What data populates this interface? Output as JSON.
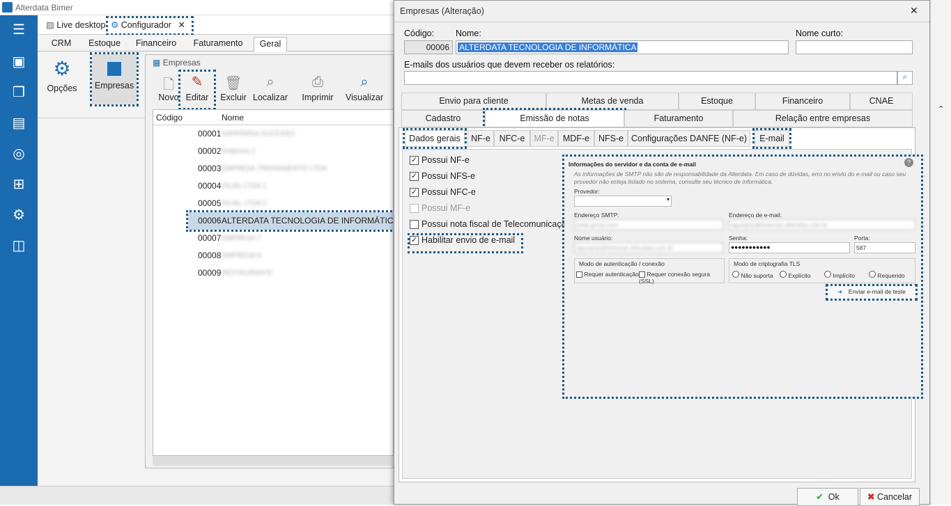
{
  "app": {
    "title": "Alterdata Bimer",
    "doc_tabs": [
      "Live desktop",
      "Configurador"
    ],
    "ribbon_tabs": [
      "CRM",
      "Estoque",
      "Financeiro",
      "Faturamento",
      "Geral"
    ],
    "ribbon_buttons": [
      "Opções",
      "Empresas"
    ]
  },
  "empresas": {
    "title": "Empresas",
    "toolbar": [
      "Novo",
      "Editar",
      "Excluir",
      "Localizar",
      "Imprimir",
      "Visualizar"
    ],
    "columns": [
      "Código",
      "Nome"
    ],
    "rows": [
      {
        "code": "00001",
        "name": "SAPATARIA SUCESSO"
      },
      {
        "code": "00002",
        "name": "Empresa 2"
      },
      {
        "code": "00003",
        "name": "EMPRESA TREINAMENTO LTDA"
      },
      {
        "code": "00004",
        "name": "FILIAL LTDA 1"
      },
      {
        "code": "00005",
        "name": "FILIAL LTDA 2"
      },
      {
        "code": "00006",
        "name": "ALTERDATA TECNOLOGIA DE INFORMÁTICA"
      },
      {
        "code": "00007",
        "name": "EMPRESA 7"
      },
      {
        "code": "00008",
        "name": "EMPRESA 8"
      },
      {
        "code": "00009",
        "name": "RESTAURANTE"
      }
    ]
  },
  "dialog": {
    "title": "Empresas (Alteração)",
    "codigo_label": "Código:",
    "codigo": "00006",
    "nome_label": "Nome:",
    "nome": "ALTERDATA TECNOLOGIA DE INFORMÁTICA",
    "nome_curto_label": "Nome curto:",
    "nome_curto": "",
    "emails_label": "E-mails dos usuários que devem receber os relatórios:",
    "tabs_row1": [
      "Envio para cliente",
      "Metas de venda",
      "Estoque",
      "Financeiro",
      "CNAE"
    ],
    "tabs_row2": [
      "Cadastro",
      "Emissão de notas",
      "Faturamento",
      "Relação entre empresas"
    ],
    "subtabs": [
      "Dados gerais",
      "NF-e",
      "NFC-e",
      "MF-e",
      "MDF-e",
      "NFS-e",
      "Configurações DANFE (NF-e)",
      "E-mail"
    ],
    "checks": [
      {
        "label": "Possui NF-e",
        "checked": true,
        "enabled": true
      },
      {
        "label": "Possui NFS-e",
        "checked": true,
        "enabled": true
      },
      {
        "label": "Possui NFC-e",
        "checked": true,
        "enabled": true
      },
      {
        "label": "Possui MF-e",
        "checked": false,
        "enabled": false
      },
      {
        "label": "Possui nota fiscal de Telecomunicação",
        "checked": false,
        "enabled": true
      },
      {
        "label": "Habilitar envio de e-mail",
        "checked": true,
        "enabled": true
      }
    ],
    "email_panel": {
      "title": "Informações do servidor e da conta de e-mail",
      "note": "As informações de SMTP não são de responsabilidade da Alterdata. Em caso de dúvidas, erro no envio do e-mail ou caso seu provedor não esteja listado no sistema, consulte seu técnico de informática.",
      "provedor_label": "Provedor:",
      "smtp_label": "Endereço SMTP:",
      "smtp": "smtp.gmail.com",
      "email_label": "Endereço de e-mail:",
      "email": "sgyoqmp@tintemas.alterdata.com.br",
      "usuario_label": "Nome usuário:",
      "usuario": "sgyoqmp@tintemas.alterdata.com.br",
      "senha_label": "Senha:",
      "senha": "●●●●●●●●●●●",
      "porta_label": "Porta:",
      "porta": "587",
      "auth_group": "Modo de autenticação / conexão",
      "auth_opt1": "Requer autenticação",
      "auth_opt2": "Requer conexão segura (SSL)",
      "tls_group": "Modo de criptografia TLS",
      "tls_opts": [
        "Não suporta",
        "Explícito",
        "Implícito",
        "Requerido"
      ],
      "test_button": "Enviar e-mail de teste"
    },
    "ok": "Ok",
    "cancel": "Cancelar"
  }
}
